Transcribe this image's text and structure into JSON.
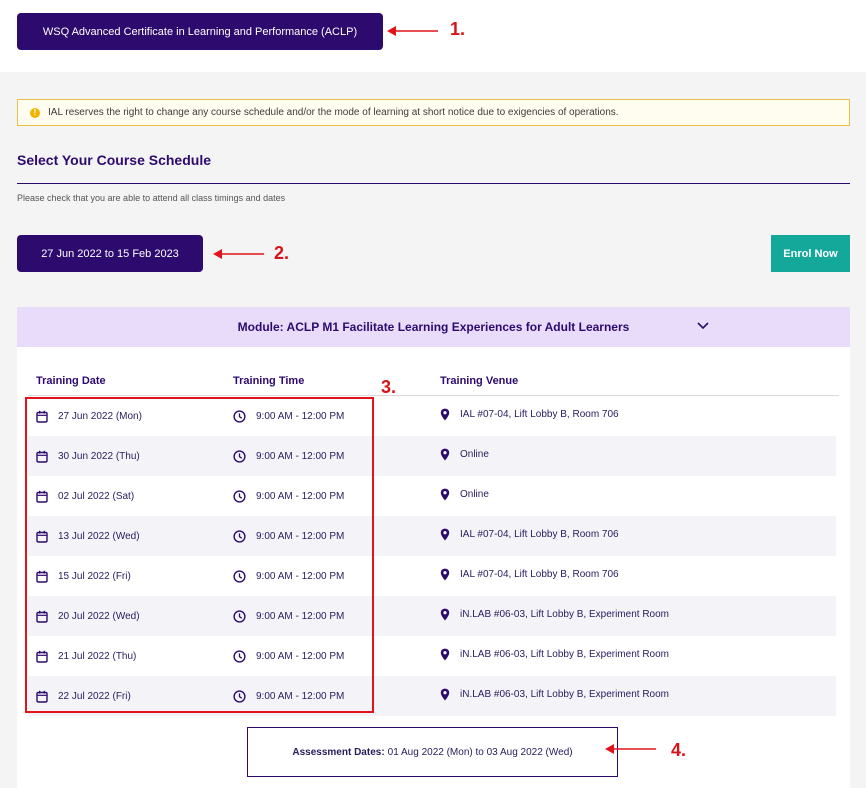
{
  "course": {
    "title": "WSQ Advanced Certificate in Learning and Performance (ACLP)"
  },
  "notice": {
    "text": "IAL reserves the right to change any course schedule and/or the mode of learning at short notice due to exigencies of operations."
  },
  "schedule": {
    "heading": "Select Your Course Schedule",
    "subnote": "Please check that you are able to attend all class timings and dates",
    "date_range": "27 Jun 2022 to 15 Feb 2023",
    "enrol_label": "Enrol Now"
  },
  "module": {
    "title": "Module: ACLP M1 Facilitate Learning Experiences for Adult Learners",
    "columns": {
      "date": "Training Date",
      "time": "Training Time",
      "venue": "Training Venue"
    },
    "rows": [
      {
        "date": "27 Jun 2022 (Mon)",
        "time": "9:00 AM - 12:00 PM",
        "venue": "IAL #07-04, Lift Lobby B, Room 706"
      },
      {
        "date": "30 Jun 2022 (Thu)",
        "time": "9:00 AM - 12:00 PM",
        "venue": "Online"
      },
      {
        "date": "02 Jul 2022 (Sat)",
        "time": "9:00 AM - 12:00 PM",
        "venue": "Online"
      },
      {
        "date": "13 Jul 2022 (Wed)",
        "time": "9:00 AM - 12:00 PM",
        "venue": "IAL #07-04, Lift Lobby B, Room 706"
      },
      {
        "date": "15 Jul 2022 (Fri)",
        "time": "9:00 AM - 12:00 PM",
        "venue": "IAL #07-04, Lift Lobby B, Room 706"
      },
      {
        "date": "20 Jul 2022 (Wed)",
        "time": "9:00 AM - 12:00 PM",
        "venue": "iN.LAB #06-03, Lift Lobby B, Experiment Room"
      },
      {
        "date": "21 Jul 2022 (Thu)",
        "time": "9:00 AM - 12:00 PM",
        "venue": "iN.LAB #06-03, Lift Lobby B, Experiment Room"
      },
      {
        "date": "22 Jul 2022 (Fri)",
        "time": "9:00 AM - 12:00 PM",
        "venue": "iN.LAB #06-03, Lift Lobby B, Experiment Room"
      }
    ],
    "assessment": {
      "label": "Assessment Dates:",
      "value": "01 Aug 2022 (Mon) to 03 Aug 2022 (Wed)"
    }
  },
  "annotations": {
    "a1": "1.",
    "a2": "2.",
    "a3": "3.",
    "a4": "4."
  },
  "colors": {
    "primary": "#2d0a6e",
    "accent": "#14a89a",
    "module_bg": "#e8dcfa",
    "annotation": "#e0141a",
    "notice_border": "#e8c14a"
  },
  "icons": {
    "notice": "info-icon",
    "date": "calendar-icon",
    "time": "clock-icon",
    "venue": "location-pin-icon",
    "toggle": "chevron-down-icon"
  }
}
